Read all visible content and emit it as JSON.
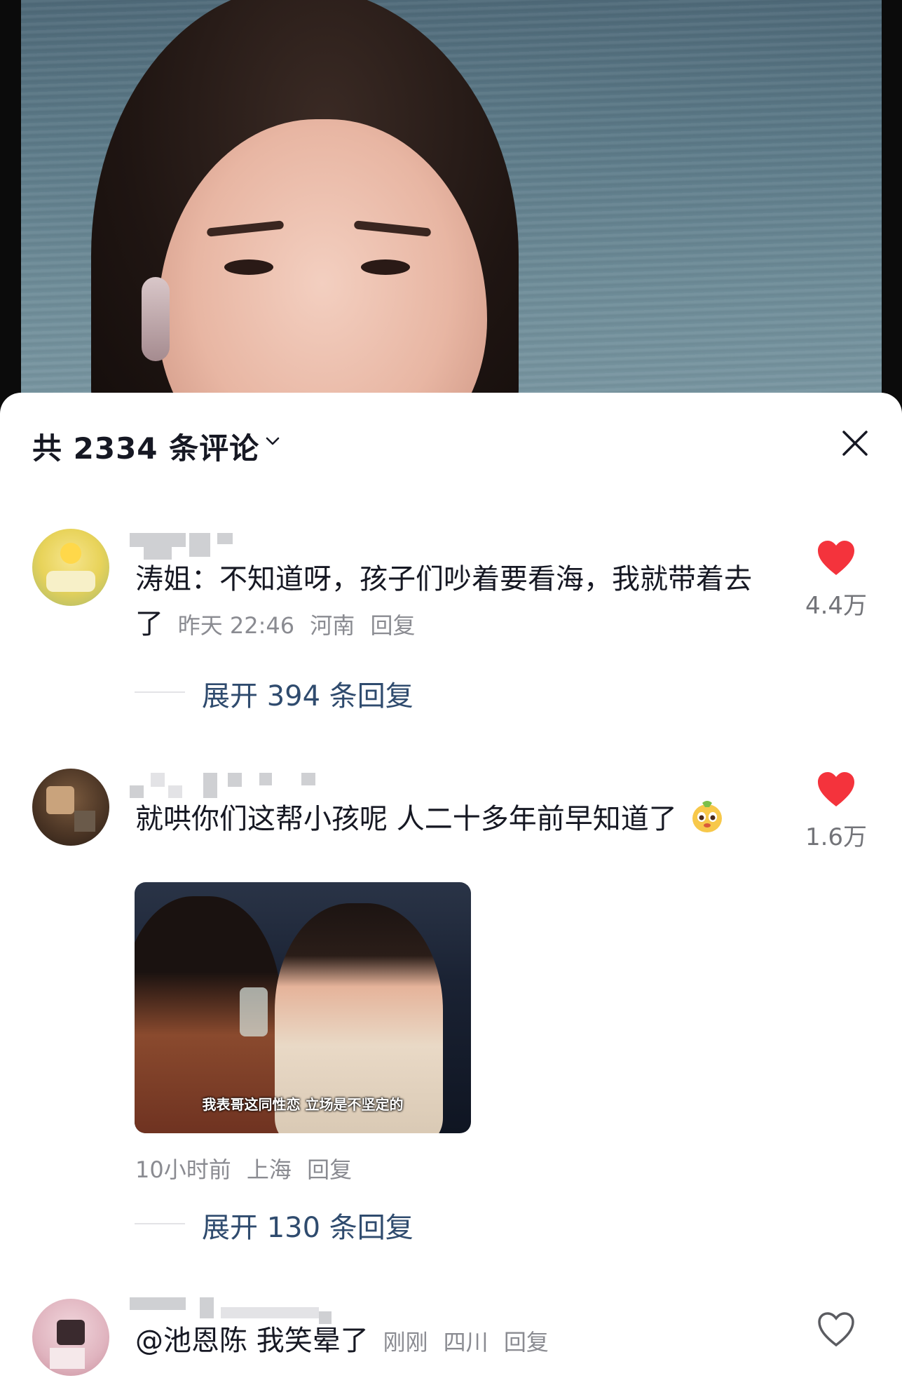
{
  "sheet": {
    "title": "共 2334 条评论"
  },
  "comments": [
    {
      "text": "涛姐：不知道呀，孩子们吵着要看海，我就带着去了",
      "time": "昨天 22:46",
      "location": "河南",
      "reply_label": "回复",
      "likes": "4.4万",
      "liked": true,
      "expand_label": "展开 394 条回复"
    },
    {
      "text": "就哄你们这帮小孩呢 人二十多年前早知道了",
      "emoji": "sticker-emoji",
      "media_caption": "我表哥这同性恋 立场是不坚定的",
      "time": "10小时前",
      "location": "上海",
      "reply_label": "回复",
      "likes": "1.6万",
      "liked": true,
      "expand_label": "展开 130 条回复"
    },
    {
      "text": "@池恩陈 我笑晕了",
      "time": "刚刚",
      "location": "四川",
      "reply_label": "回复",
      "liked": false
    }
  ],
  "colors": {
    "heart_liked": "#f4333c",
    "heart_outline": "#5b5c61",
    "expand_text": "#2f4b6e",
    "meta_text": "#8a8b91",
    "body_text": "#161823"
  }
}
